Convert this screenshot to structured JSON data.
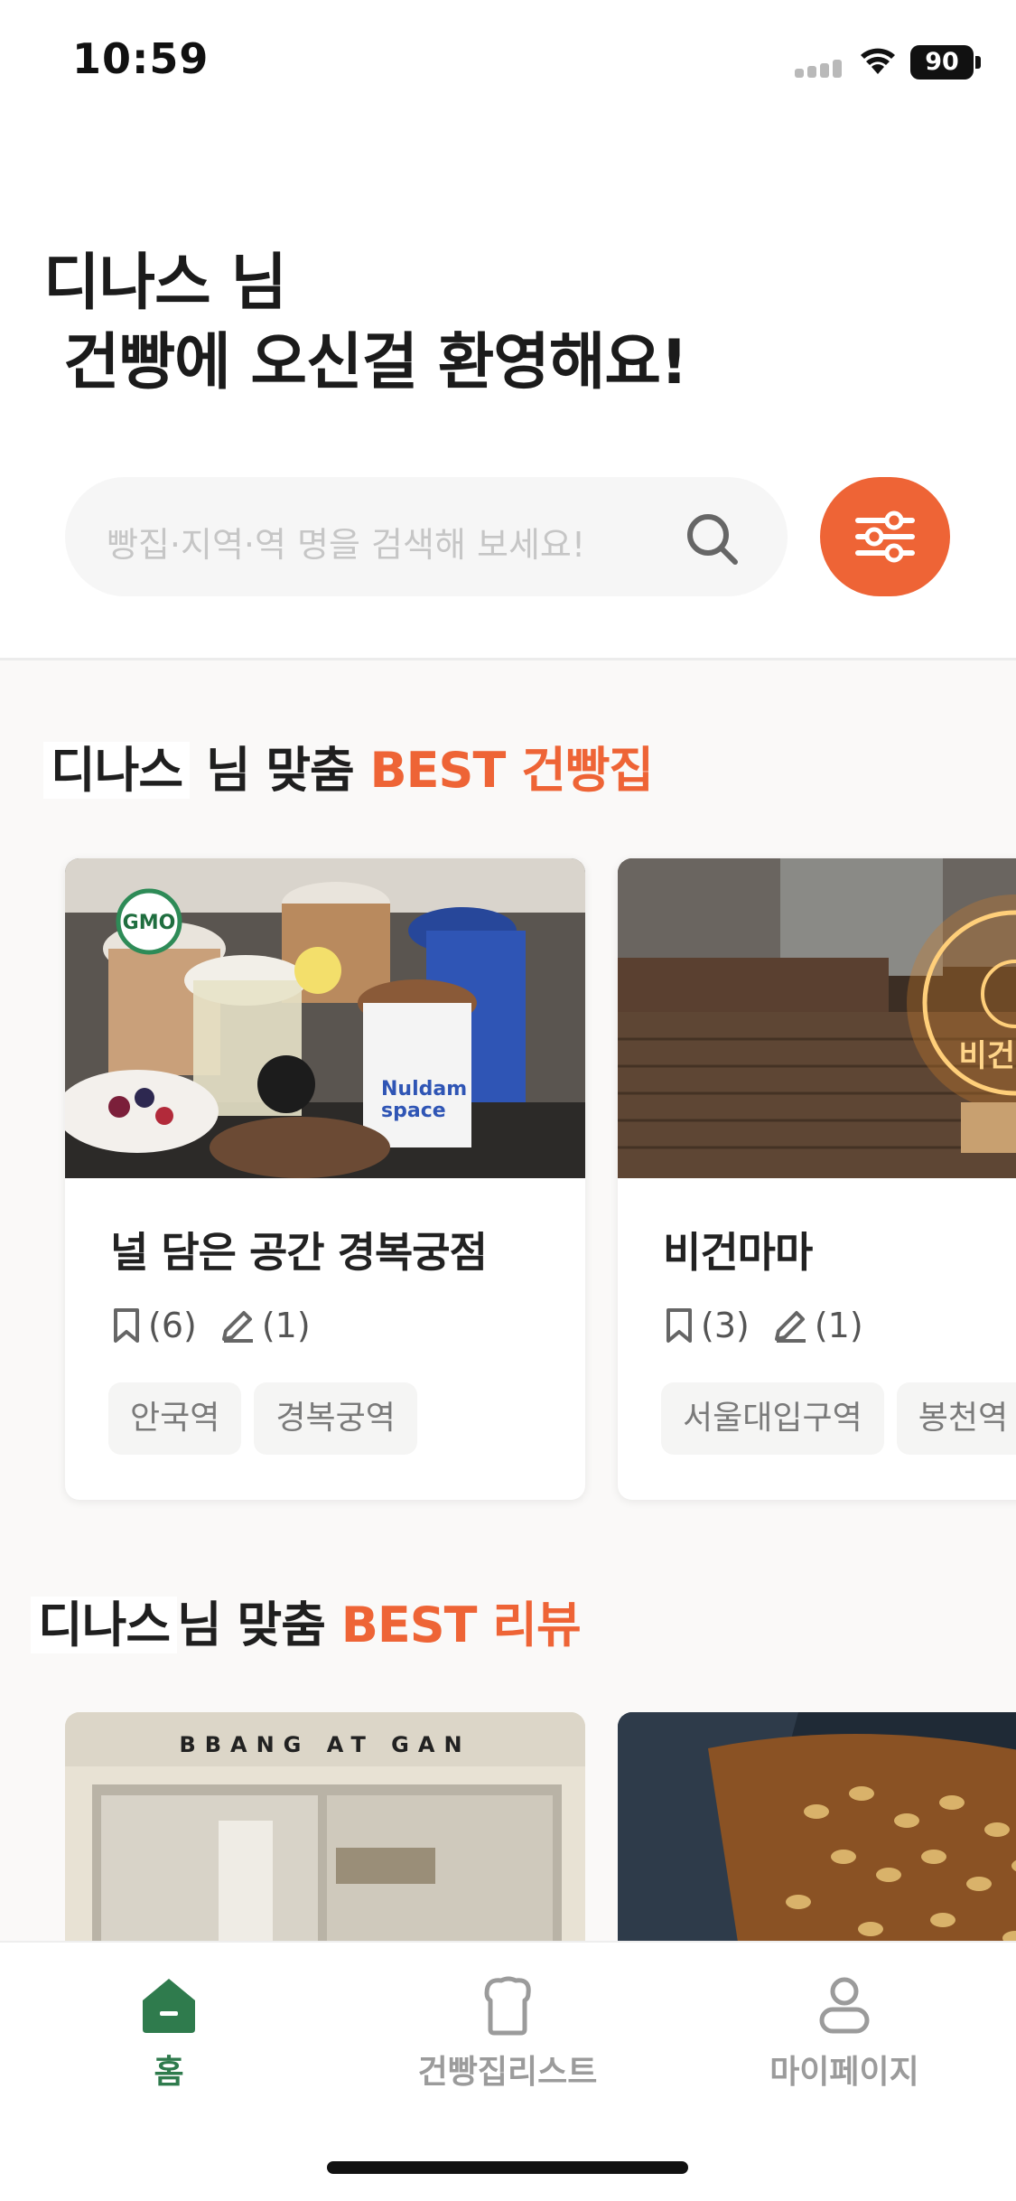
{
  "status_bar": {
    "time": "10:59",
    "battery": "90"
  },
  "greeting": {
    "name_line": "디나스 님",
    "welcome_line": "건빵에 오신걸 환영해요!"
  },
  "search": {
    "placeholder": "빵집·지역·역 명을 검색해 보세요!"
  },
  "best_bakery_section": {
    "name": "디나스",
    "middle": " 님 맞춤 ",
    "accent": "BEST 건빵집",
    "cards": [
      {
        "title": "널 담은 공간 경복궁점",
        "bookmarks": "(6)",
        "reviews": "(1)",
        "tags": [
          "안국역",
          "경복궁역"
        ]
      },
      {
        "title": "비건마마",
        "bookmarks": "(3)",
        "reviews": "(1)",
        "tags": [
          "서울대입구역",
          "봉천역"
        ]
      }
    ]
  },
  "best_review_section": {
    "name": "디나스",
    "middle": "님 맞춤 ",
    "accent": "BEST 리뷰",
    "storefront_sign": "BBANG AT GAN"
  },
  "tab_bar": {
    "items": [
      {
        "label": "홈",
        "icon": "home-icon",
        "active": true
      },
      {
        "label": "건빵집리스트",
        "icon": "bread-icon",
        "active": false
      },
      {
        "label": "마이페이지",
        "icon": "person-icon",
        "active": false
      }
    ],
    "active_color": "#2f7b4d",
    "inactive_color": "#9b9b9b"
  },
  "colors": {
    "accent": "#ee6436",
    "brand_green": "#2f7b4d"
  }
}
